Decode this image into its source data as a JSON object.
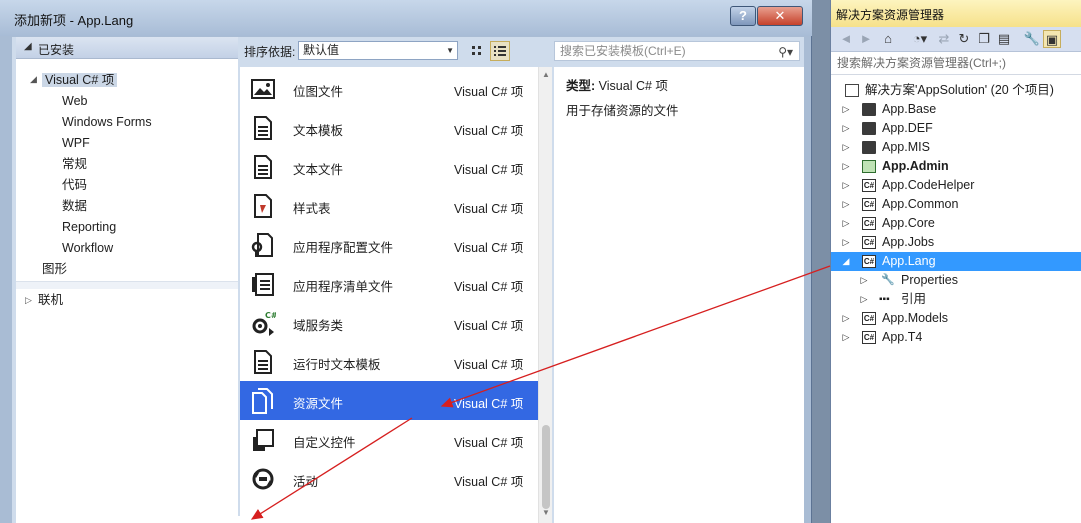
{
  "dialog": {
    "title": "添加新项 - App.Lang",
    "help_label": "?",
    "close_label": "✕"
  },
  "left_panel": {
    "installed_header": "已安装",
    "tree": [
      {
        "label": "Visual C# 项",
        "selected": true
      },
      {
        "label": "Web"
      },
      {
        "label": "Windows Forms"
      },
      {
        "label": "WPF"
      },
      {
        "label": "常规"
      },
      {
        "label": "代码"
      },
      {
        "label": "数据"
      },
      {
        "label": "Reporting"
      },
      {
        "label": "Workflow"
      },
      {
        "label": "图形"
      }
    ],
    "online_header": "联机"
  },
  "toolbar": {
    "sort_label": "排序依据:",
    "sort_value": "默认值",
    "search_placeholder": "搜索已安装模板(Ctrl+E)"
  },
  "templates": [
    {
      "name": "位图文件",
      "lang": "Visual C# 项",
      "icon": "bitmap-icon"
    },
    {
      "name": "文本模板",
      "lang": "Visual C# 项",
      "icon": "document-icon"
    },
    {
      "name": "文本文件",
      "lang": "Visual C# 项",
      "icon": "document-icon"
    },
    {
      "name": "样式表",
      "lang": "Visual C# 项",
      "icon": "stylesheet-icon"
    },
    {
      "name": "应用程序配置文件",
      "lang": "Visual C# 项",
      "icon": "config-icon"
    },
    {
      "name": "应用程序清单文件",
      "lang": "Visual C# 项",
      "icon": "manifest-icon"
    },
    {
      "name": "域服务类",
      "lang": "Visual C# 项",
      "icon": "service-icon"
    },
    {
      "name": "运行时文本模板",
      "lang": "Visual C# 项",
      "icon": "document-icon"
    },
    {
      "name": "资源文件",
      "lang": "Visual C# 项",
      "icon": "resource-icon",
      "selected": true
    },
    {
      "name": "自定义控件",
      "lang": "Visual C# 项",
      "icon": "control-icon"
    },
    {
      "name": "活动",
      "lang": "Visual C# 项",
      "icon": "activity-icon"
    }
  ],
  "details": {
    "type_label": "类型:",
    "type_value": "Visual C# 项",
    "description": "用于存储资源的文件"
  },
  "solution_explorer": {
    "title": "解决方案资源管理器",
    "search_placeholder": "搜索解决方案资源管理器(Ctrl+;)",
    "solution_label": "解决方案'AppSolution' (20 个项目)",
    "items": [
      {
        "label": "App.Base",
        "kind": "folder"
      },
      {
        "label": "App.DEF",
        "kind": "folder"
      },
      {
        "label": "App.MIS",
        "kind": "folder"
      },
      {
        "label": "App.Admin",
        "kind": "web",
        "bold": true
      },
      {
        "label": "App.CodeHelper",
        "kind": "cs"
      },
      {
        "label": "App.Common",
        "kind": "cs"
      },
      {
        "label": "App.Core",
        "kind": "cs"
      },
      {
        "label": "App.Jobs",
        "kind": "cs"
      },
      {
        "label": "App.Lang",
        "kind": "cs",
        "selected": true,
        "expanded": true
      },
      {
        "label": "Properties",
        "kind": "wrench",
        "child": true
      },
      {
        "label": "引用",
        "kind": "ref",
        "child": true
      },
      {
        "label": "App.Models",
        "kind": "cs"
      },
      {
        "label": "App.T4",
        "kind": "cs"
      }
    ]
  },
  "colors": {
    "selection_blue": "#3368e3",
    "explorer_selection": "#3399ff",
    "annotation_red": "#d61f1f",
    "explorer_title_yellow": "#f6e18a"
  }
}
